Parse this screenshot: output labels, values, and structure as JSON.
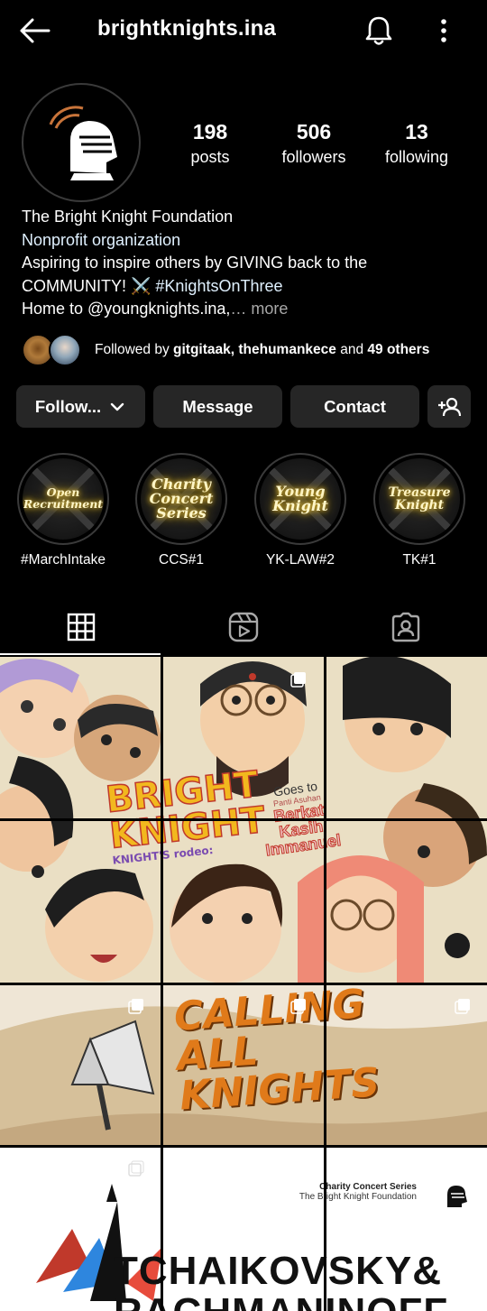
{
  "header": {
    "username": "brightknights.ina",
    "icons": [
      "back-arrow-icon",
      "bell-icon",
      "more-vertical-icon"
    ]
  },
  "stats": [
    {
      "value": "198",
      "label": "posts"
    },
    {
      "value": "506",
      "label": "followers"
    },
    {
      "value": "13",
      "label": "following"
    }
  ],
  "bio": {
    "name": "The Bright Knight Foundation",
    "category": "Nonprofit organization",
    "line1": "Aspiring to inspire others by GIVING back to the",
    "line2_text": "COMMUNITY! ⚔️ ",
    "hashtag": "#KnightsOnThree",
    "line3_text": "Home to @youngknights.ina,",
    "more": "… more"
  },
  "followed_by": {
    "prefix": "Followed by ",
    "names": "gitgitaak, thehumankece",
    "middle": " and ",
    "others": "49 others"
  },
  "buttons": {
    "follow": "Follow...",
    "message": "Message",
    "contact": "Contact"
  },
  "highlights": [
    {
      "title": "Open Recruitment",
      "label": "#MarchIntake"
    },
    {
      "title": "Charity Concert Series",
      "label": "CCS#1"
    },
    {
      "title": "Young Knight",
      "label": "YK-LAW#2"
    },
    {
      "title": "Treasure Knight",
      "label": "TK#1"
    }
  ],
  "tabs": [
    "grid-icon",
    "reels-icon",
    "tagged-icon"
  ],
  "posts": {
    "post1": {
      "title_top": "BRIGHT",
      "title_bottom": "KNIGHT",
      "subtitle": "KNIGHT'S rodeo:",
      "goes_to": "Goes to",
      "place_small": "Panti Asuhan",
      "place": "Berkat Kasih Immanuel"
    },
    "post2": {
      "headline": [
        "CALLING",
        "ALL",
        "KNIGHTS"
      ]
    },
    "post3": {
      "series": "Charity Concert Series",
      "foundation": "The Bright Knight Foundation",
      "headline": "TCHAIKOVSKY&",
      "headline2": "RACHMANINOFF"
    }
  },
  "colors": {
    "background": "#000000",
    "button": "#262626",
    "link": "#e0f1ff",
    "muted": "#a8a8a8",
    "highlight_glow": "#ffd23c",
    "poster_orange": "#e07a1a",
    "poster_bg": "#eadfc4"
  }
}
